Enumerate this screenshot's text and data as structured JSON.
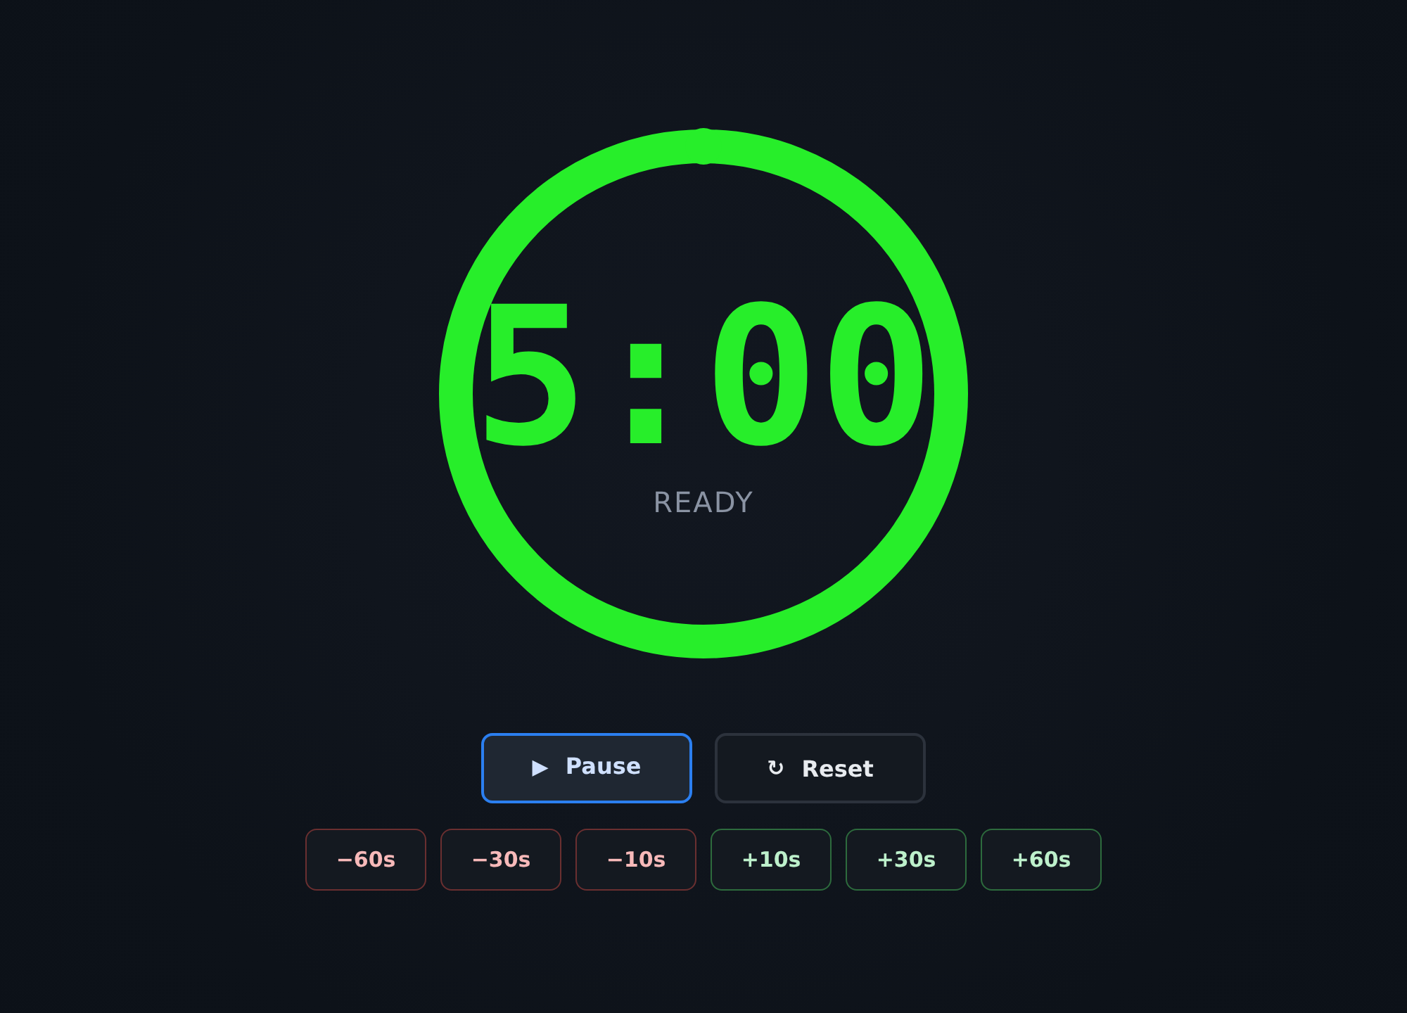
{
  "timer": {
    "time": "5:00",
    "status": "READY",
    "level": 1
  },
  "controls": [
    {
      "kind": "primary",
      "icon": "▶",
      "label": "Pause"
    },
    {
      "kind": "secondary",
      "icon": "↻",
      "label": "Reset"
    }
  ],
  "adjust": [
    {
      "kind": "decrease",
      "label": "−60s"
    },
    {
      "kind": "decrease",
      "label": "−30s"
    },
    {
      "kind": "decrease",
      "label": "−10s"
    },
    {
      "kind": "increase",
      "label": "+10s"
    },
    {
      "kind": "increase",
      "label": "+30s"
    },
    {
      "kind": "increase",
      "label": "+60s"
    }
  ]
}
